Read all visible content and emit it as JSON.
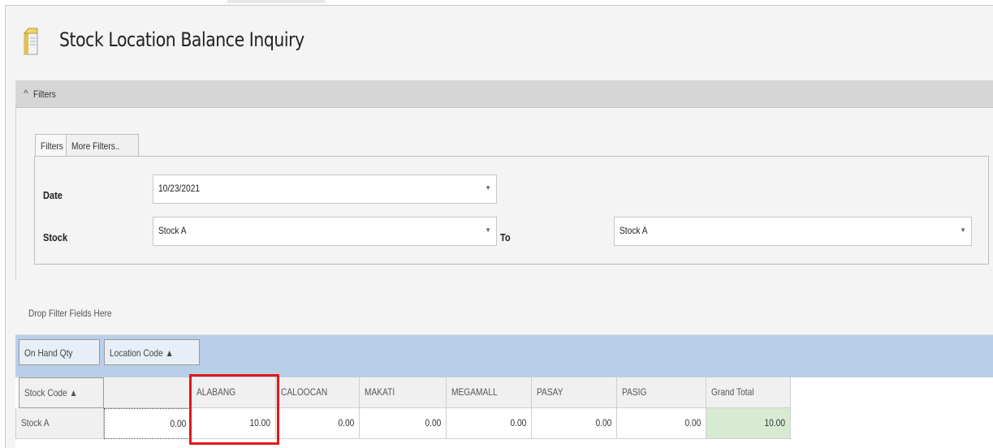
{
  "window": {
    "title": "Stock Location Balance Inquiry",
    "icon": "box-icon"
  },
  "filters_section": {
    "caret": "^",
    "label": "Filters"
  },
  "tabs": [
    {
      "label": "Filters"
    },
    {
      "label": "More Filters.."
    }
  ],
  "filters": {
    "date": {
      "label": "Date",
      "value": "10/23/2021"
    },
    "stock_from": {
      "label": "Stock",
      "value": "Stock A"
    },
    "to_label": "To",
    "stock_to": {
      "value": "Stock A"
    }
  },
  "pivot": {
    "drop_area_text": "Drop Filter Fields Here",
    "data_fields": [
      {
        "label": "On Hand Qty"
      },
      {
        "label": "Location Code ▲"
      }
    ],
    "row_field": {
      "label": "Stock Code ▲"
    },
    "columns": [
      "",
      "ALABANG",
      "CALOOCAN",
      "MAKATI",
      "MEGAMALL",
      "PASAY",
      "PASIG",
      "Grand Total"
    ],
    "rows": [
      {
        "label": "Stock A",
        "values": [
          "0.00",
          "10.00",
          "0.00",
          "0.00",
          "0.00",
          "0.00",
          "0.00",
          "10.00"
        ]
      }
    ]
  },
  "colors": {
    "highlight_border": "#e0181a",
    "grand_total_fill": "#d7ead2",
    "data_area_fill": "#b9cfe8"
  }
}
